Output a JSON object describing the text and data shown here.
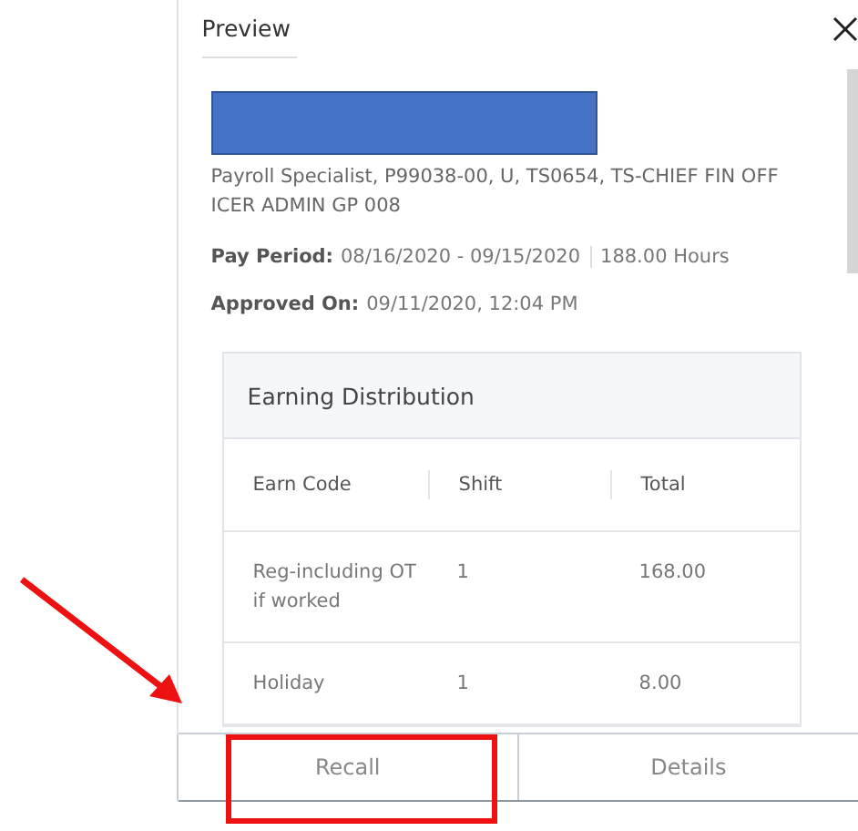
{
  "panel": {
    "title": "Preview",
    "redacted": true,
    "position": "Payroll Specialist, P99038-00, U, TS0654, TS-CHIEF FIN OFFICER ADMIN GP 008",
    "pay_period": {
      "label": "Pay Period:",
      "value": "08/16/2020 - 09/15/2020",
      "hours": "188.00 Hours"
    },
    "approved_on": {
      "label": "Approved On:",
      "value": "09/11/2020, 12:04 PM"
    },
    "earning_distribution": {
      "title": "Earning Distribution",
      "columns": [
        "Earn Code",
        "Shift",
        "Total"
      ],
      "rows": [
        [
          "Reg-including OT if worked",
          "1",
          "168.00"
        ],
        [
          "Holiday",
          "1",
          "8.00"
        ]
      ]
    },
    "buttons": [
      "Recall",
      "Details"
    ]
  },
  "annotations": [
    {
      "kind": "arrow"
    },
    {
      "kind": "highlight"
    }
  ]
}
